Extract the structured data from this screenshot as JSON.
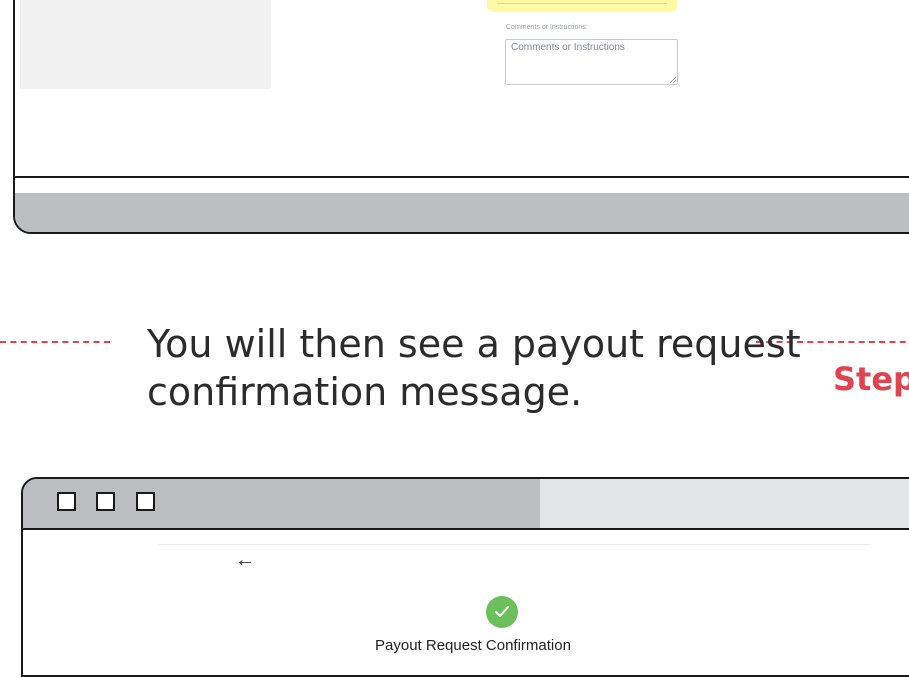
{
  "top_window": {
    "comments_label": "Comments or Instructions:",
    "comments_placeholder": "Comments or Instructions"
  },
  "step": {
    "text_line1": "You will then see a payout request",
    "text_line2": "confirmation message.",
    "next_step_label": "Step"
  },
  "bottom_window": {
    "back_icon": "back-arrow-icon",
    "success_icon": "check-icon",
    "title": "Payout Request Confirmation"
  },
  "colors": {
    "accent_red": "#e04450",
    "frame_gray": "#bcbdbf",
    "success_green": "#6cc05b",
    "highlight_yellow": "#fff9a6"
  }
}
